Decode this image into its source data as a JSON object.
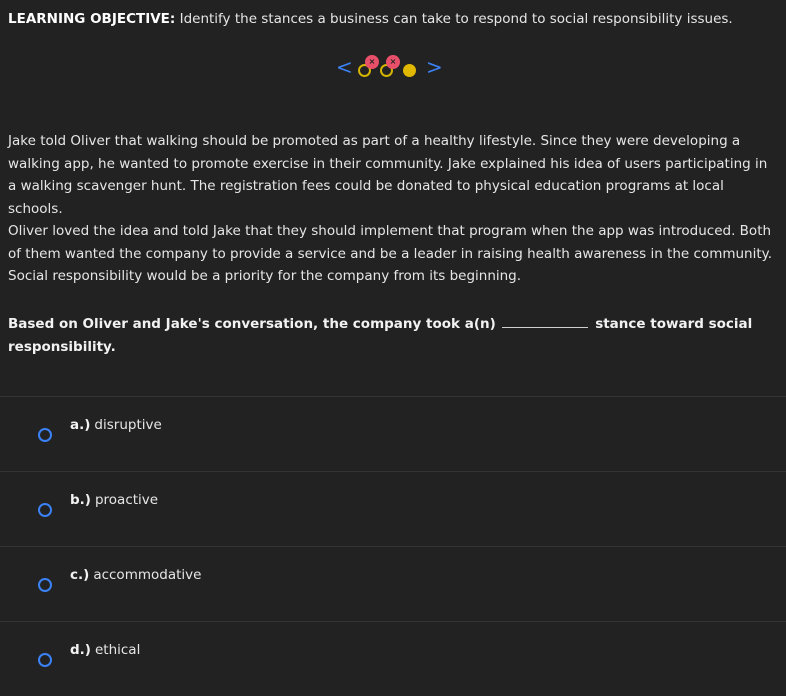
{
  "objective": {
    "label": "LEARNING OBJECTIVE:",
    "text": " Identify the stances a business can take to respond to social responsibility issues."
  },
  "nav": {
    "prev_icon": "chevron-left-icon",
    "next_icon": "chevron-right-icon",
    "prev_glyph": "<",
    "next_glyph": ">",
    "badge_glyph": "×",
    "dot_color": "#e0b800",
    "badge_color": "#e8506a",
    "accent_color": "#3b82f6"
  },
  "passage": {
    "paragraph1": "Jake told Oliver that walking should be promoted as part of a healthy lifestyle. Since they were developing a walking app, he wanted to promote exercise in their community. Jake explained his idea of users participating in a walking scavenger hunt. The registration fees could be donated to physical education programs at local schools.",
    "paragraph2": "Oliver loved the idea and told Jake that they should implement that program when the app was introduced. Both of them wanted the company to provide a service and be a leader in raising health awareness in the community. Social responsibility would be a priority for the company from its beginning."
  },
  "question": {
    "before_blank": "Based on Oliver and Jake's conversation, the company took a(n)",
    "after_blank": "stance toward social responsibility."
  },
  "options": [
    {
      "letter": "a.)",
      "text": "disruptive"
    },
    {
      "letter": "b.)",
      "text": "proactive"
    },
    {
      "letter": "c.)",
      "text": "accommodative"
    },
    {
      "letter": "d.)",
      "text": "ethical"
    }
  ]
}
